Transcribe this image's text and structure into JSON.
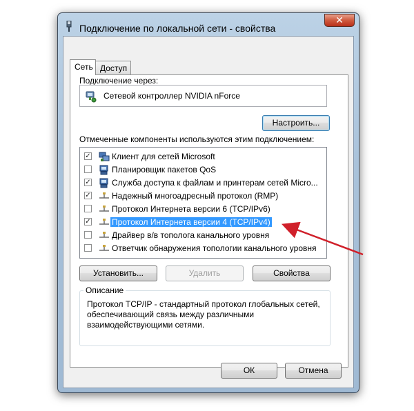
{
  "window": {
    "title": "Подключение по локальной сети - свойства",
    "close_glyph": "✕"
  },
  "tabs": [
    {
      "label": "Сеть",
      "active": true
    },
    {
      "label": "Доступ",
      "active": false
    }
  ],
  "connect_via": {
    "label": "Подключение через:",
    "adapter": "Сетевой контроллер NVIDIA nForce",
    "icon": "network-adapter-icon"
  },
  "configure_label": "Настроить...",
  "components": {
    "label": "Отмеченные компоненты используются этим подключением:",
    "items": [
      {
        "checked": true,
        "label": "Клиент для сетей Microsoft",
        "icon": "network-client-icon"
      },
      {
        "checked": false,
        "label": "Планировщик пакетов QoS",
        "icon": "network-service-icon"
      },
      {
        "checked": true,
        "label": "Служба доступа к файлам и принтерам сетей Micro...",
        "icon": "network-service-icon"
      },
      {
        "checked": true,
        "label": "Надежный многоадресный протокол (RMP)",
        "icon": "protocol-icon"
      },
      {
        "checked": false,
        "label": "Протокол Интернета версии 6 (TCP/IPv6)",
        "icon": "protocol-icon"
      },
      {
        "checked": true,
        "label": "Протокол Интернета версии 4 (TCP/IPv4)",
        "icon": "protocol-icon",
        "selected": true
      },
      {
        "checked": false,
        "label": "Драйвер в/в тополога канального уровня",
        "icon": "protocol-icon"
      },
      {
        "checked": false,
        "label": "Ответчик обнаружения топологии канального уровня",
        "icon": "protocol-icon"
      }
    ]
  },
  "actions": {
    "install": "Установить...",
    "remove": "Удалить",
    "properties": "Свойства"
  },
  "description": {
    "title": "Описание",
    "text": "Протокол TCP/IP - стандартный протокол глобальных сетей, обеспечивающий связь между различными взаимодействующими сетями."
  },
  "footer": {
    "ok": "ОК",
    "cancel": "Отмена"
  },
  "colors": {
    "selection": "#3399ff",
    "annotation_arrow": "#d0202a"
  }
}
